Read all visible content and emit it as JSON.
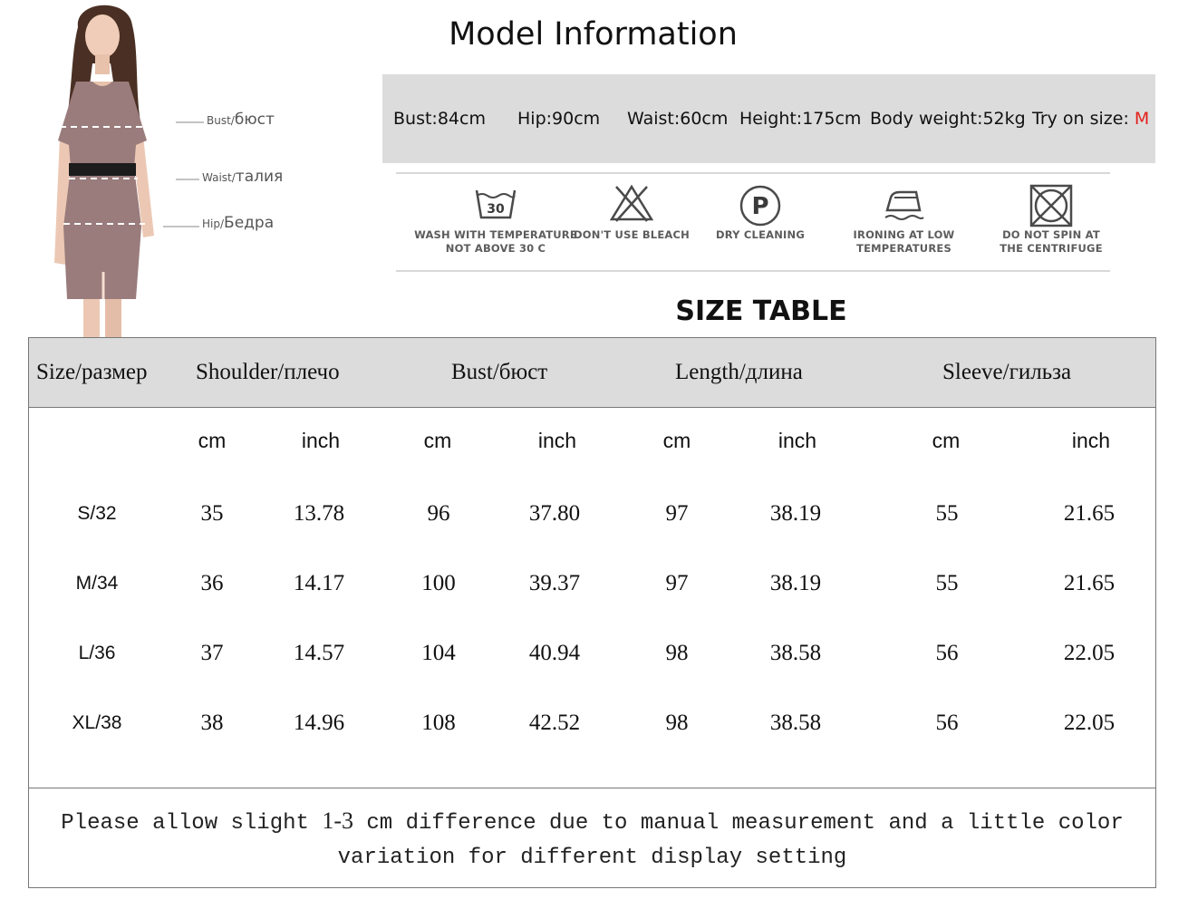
{
  "model": {
    "title": "Model Information",
    "figure_labels": [
      {
        "en": "Bust/",
        "ru": "бюст"
      },
      {
        "en": "Waist/",
        "ru": "талия"
      },
      {
        "en": "Hip/",
        "ru": "Бедра"
      }
    ],
    "stats": [
      {
        "text": "Bust:84cm"
      },
      {
        "text": "Hip:90cm"
      },
      {
        "text": "Waist:60cm"
      },
      {
        "text": "Height:175cm"
      },
      {
        "text": "Body weight:52kg"
      },
      {
        "text": "Try on size: ",
        "highlight": "M"
      }
    ],
    "highlight_color": "#e3201c"
  },
  "care": {
    "items": [
      {
        "icon": "wash-30-icon",
        "label": "WASH WITH TEMPERATURE\nNOT ABOVE 30 C",
        "temp": "30"
      },
      {
        "icon": "no-bleach-icon",
        "label": "DON'T USE BLEACH"
      },
      {
        "icon": "dry-clean-icon",
        "label": "DRY CLEANING",
        "letter": "P"
      },
      {
        "icon": "iron-low-icon",
        "label": "IRONING AT LOW\nTEMPERATURES"
      },
      {
        "icon": "no-spin-icon",
        "label": "DO NOT SPIN AT\nTHE CENTRIFUGE"
      }
    ]
  },
  "size_table": {
    "title": "SIZE TABLE",
    "headers": [
      "Size/размер",
      "Shoulder/плечо",
      "Bust/бюст",
      "Length/длина",
      "Sleeve/гильза"
    ],
    "units": [
      "cm",
      "inch",
      "cm",
      "inch",
      "cm",
      "inch",
      "cm",
      "inch"
    ],
    "rows": [
      {
        "size": "S/32",
        "values": [
          "35",
          "13.78",
          "96",
          "37.80",
          "97",
          "38.19",
          "55",
          "21.65"
        ]
      },
      {
        "size": "M/34",
        "values": [
          "36",
          "14.17",
          "100",
          "39.37",
          "97",
          "38.19",
          "55",
          "21.65"
        ]
      },
      {
        "size": "L/36",
        "values": [
          "37",
          "14.57",
          "104",
          "40.94",
          "98",
          "38.58",
          "56",
          "22.05"
        ]
      },
      {
        "size": "XL/38",
        "values": [
          "38",
          "14.96",
          "108",
          "42.52",
          "98",
          "38.58",
          "56",
          "22.05"
        ]
      }
    ]
  },
  "note": {
    "before": "Please allow slight ",
    "range": "1-3",
    "after": " cm difference due to manual measurement and a little color variation for different display setting"
  }
}
